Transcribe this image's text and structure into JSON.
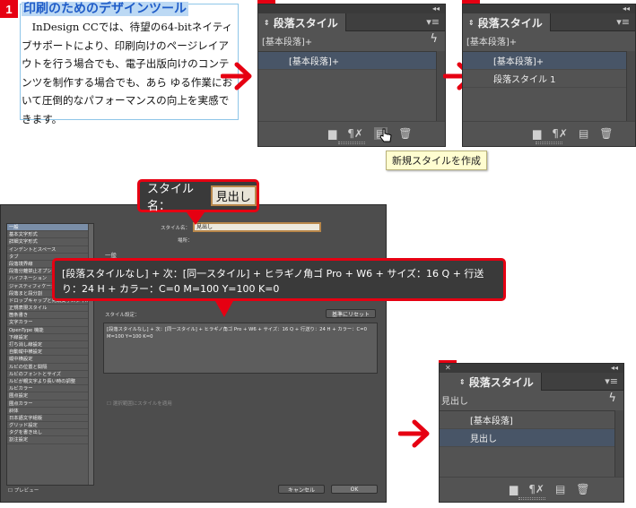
{
  "step1": {
    "badge": "1",
    "heading": "印刷のためのデザインツール",
    "lines": [
      "　InDesign CCでは、待望の64-bitネイティ",
      "ブサポートにより、印刷向けのページレイア",
      "ウトを行う場合でも、電子出版向けのコンテ",
      "ンツを制作する場合でも、あら ゆる作業にお",
      "いて圧倒的なパフォーマンスの向上を実感で",
      "きます。"
    ]
  },
  "step2": {
    "badge": "2",
    "panel_title": "段落スタイル",
    "current_style": "[基本段落]+",
    "items": [
      "[基本段落]+"
    ],
    "tooltip": "新規スタイルを作成"
  },
  "step3": {
    "badge": "3",
    "panel_title": "段落スタイル",
    "current_style": "[基本段落]+",
    "items": [
      "[基本段落]+",
      "段落スタイル 1"
    ]
  },
  "step4": {
    "badge": "4",
    "style_name_label": "スタイル名：",
    "style_name_value": "見出し",
    "dialog": {
      "style_name_label": "スタイル名：",
      "style_name_value": "見出し",
      "location_label": "場所：",
      "section_title": "一般",
      "style_settings_label": "スタイル設定：",
      "reset_button": "基準にリセット",
      "settings_text": "[段落スタイルなし] + 次：[同一スタイル] + ヒラギノ角ゴ Pro + W6 + サイズ：16 Q + 行送り：24 H + カラー：C=0 M=100 Y=100 K=0",
      "apply_to_selection": "選択範囲にスタイルを適用",
      "preview_label": "プレビュー",
      "cancel_button": "キャンセル",
      "ok_button": "OK",
      "categories": [
        "一般",
        "基本文字形式",
        "詳細文字形式",
        "インデントとスペース",
        "タブ",
        "段落境界線",
        "段落分離禁止オプション",
        "ハイフネーション",
        "ジャスティフィケーション",
        "段落まと段分割",
        "ドロップキャップと先頭文字スタイル",
        "正規表現スタイル",
        "箇条書き",
        "文字カラー",
        "OpenType 機能",
        "下線設定",
        "打ち消し線設定",
        "自動縦中横設定",
        "縦中横設定",
        "ルビの位置と間隔",
        "ルビのフォントとサイズ",
        "ルビが親文字より長い時の調整",
        "ルビカラー",
        "圏点設定",
        "圏点カラー",
        "斜体",
        "日本語文字組版",
        "グリッド設定",
        "タグを書き出し",
        "割注設定"
      ]
    },
    "callout_text": "[段落スタイルなし] + 次：[同一スタイル] + ヒラギノ角ゴ Pro + W6 + サイズ：16 Q + 行送り：24 H + カラー：C=0 M=100 Y=100 K=0"
  },
  "step5": {
    "badge": "5",
    "panel_title": "段落スタイル",
    "current_style": "見出し",
    "items": [
      "[基本段落]",
      "見出し"
    ]
  },
  "colors": {
    "accent_red": "#e60012",
    "panel_bg": "#535353",
    "selection": "#485567",
    "text_highlight": "#bcd9f4",
    "heading_blue": "#1f5cc8"
  }
}
